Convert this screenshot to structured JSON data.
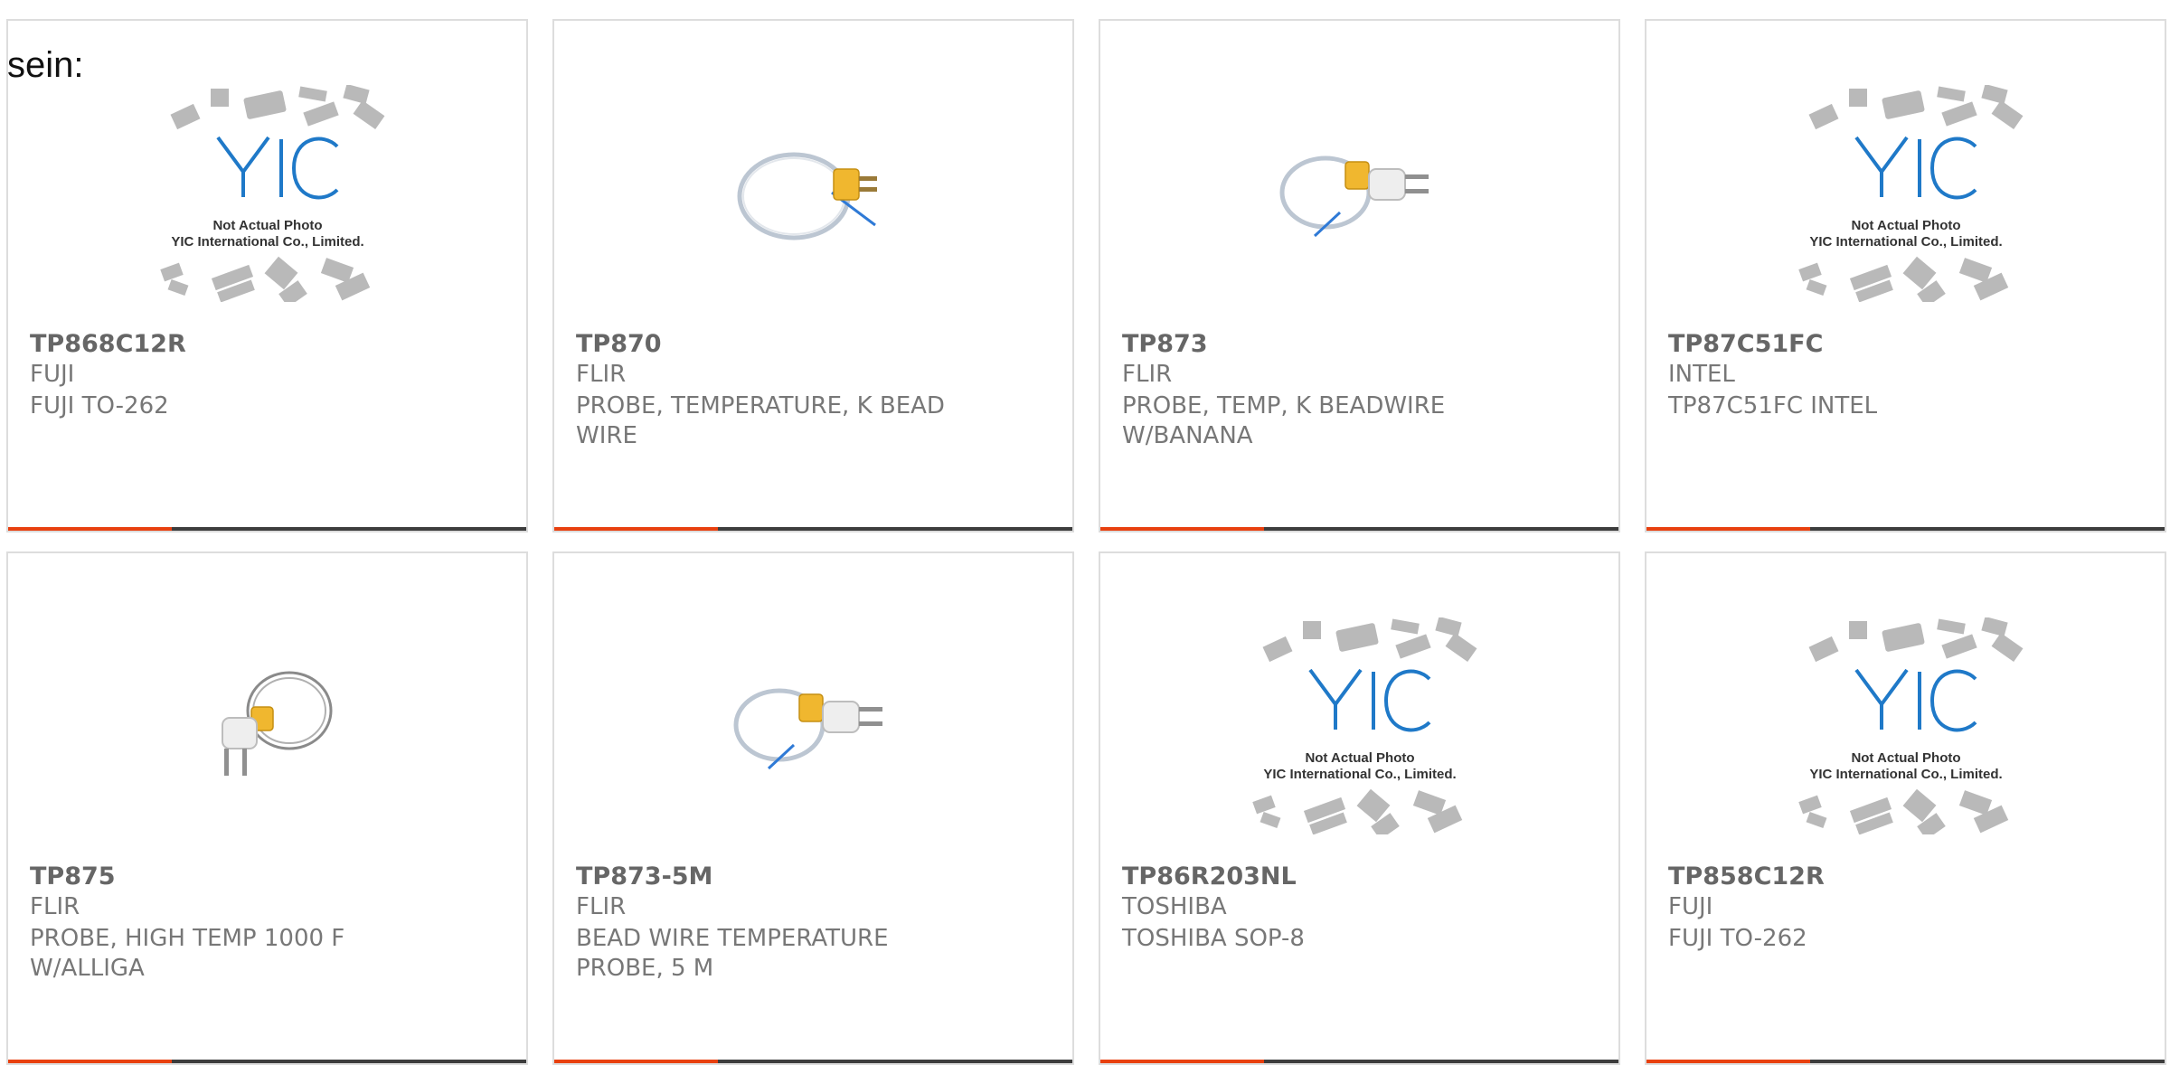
{
  "page": {
    "intro_text": "sein:"
  },
  "colors": {
    "accent": "#e8400f",
    "bar": "#3d3d3d",
    "border": "#dddddd",
    "text": "#777777"
  },
  "products": [
    {
      "part": "TP868C12R",
      "brand": "FUJI",
      "description": "FUJI TO-262",
      "image": "placeholder-photo-icon",
      "placeholder_lines": [
        "Not Actual Photo",
        "YIC International Co., Limited."
      ]
    },
    {
      "part": "TP870",
      "brand": "FLIR",
      "description": "PROBE, TEMPERATURE, K BEAD WIRE",
      "image": "thermocouple-probe-icon"
    },
    {
      "part": "TP873",
      "brand": "FLIR",
      "description": "PROBE, TEMP, K BEADWIRE W/BANANA",
      "image": "banana-probe-icon"
    },
    {
      "part": "TP87C51FC",
      "brand": "INTEL",
      "description": "TP87C51FC INTEL",
      "image": "placeholder-photo-icon",
      "placeholder_lines": [
        "Not Actual Photo",
        "YIC International Co., Limited."
      ]
    },
    {
      "part": "TP875",
      "brand": "FLIR",
      "description": "PROBE, HIGH TEMP 1000 F W/ALLIGA",
      "image": "high-temp-probe-icon"
    },
    {
      "part": "TP873-5M",
      "brand": "FLIR",
      "description": "BEAD WIRE TEMPERATURE PROBE, 5 M",
      "image": "banana-probe-icon"
    },
    {
      "part": "TP86R203NL",
      "brand": "TOSHIBA",
      "description": "TOSHIBA SOP-8",
      "image": "placeholder-photo-icon",
      "placeholder_lines": [
        "Not Actual Photo",
        "YIC International Co., Limited."
      ]
    },
    {
      "part": "TP858C12R",
      "brand": "FUJI",
      "description": "FUJI TO-262",
      "image": "placeholder-photo-icon",
      "placeholder_lines": [
        "Not Actual Photo",
        "YIC International Co., Limited."
      ]
    }
  ]
}
